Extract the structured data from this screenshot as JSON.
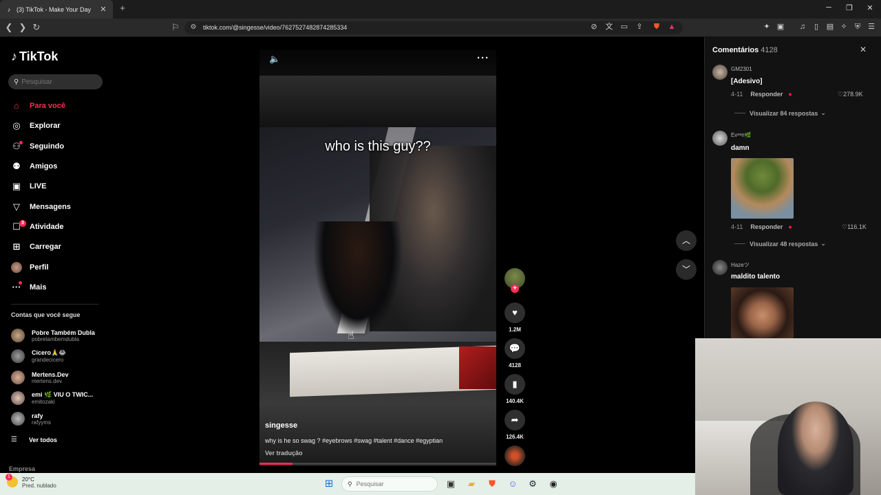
{
  "browser": {
    "tab_title": "(3) TikTok - Make Your Day",
    "url": "tiktok.com/@singesse/video/7627527482874285334",
    "new_tab_symbol": "+"
  },
  "sidebar": {
    "logo": "TikTok",
    "search_placeholder": "Pesquisar",
    "nav": [
      {
        "label": "Para você",
        "icon": "home-icon"
      },
      {
        "label": "Explorar",
        "icon": "compass-icon"
      },
      {
        "label": "Seguindo",
        "icon": "following-icon"
      },
      {
        "label": "Amigos",
        "icon": "friends-icon"
      },
      {
        "label": "LIVE",
        "icon": "live-icon"
      },
      {
        "label": "Mensagens",
        "icon": "messages-icon"
      },
      {
        "label": "Atividade",
        "icon": "activity-icon",
        "badge": "3"
      },
      {
        "label": "Carregar",
        "icon": "upload-icon"
      },
      {
        "label": "Perfil",
        "icon": "profile-avatar"
      },
      {
        "label": "Mais",
        "icon": "more-icon"
      }
    ],
    "following_heading": "Contas que você segue",
    "accounts": [
      {
        "name": "Pobre Também Dubla",
        "handle": "pobretambemdubla"
      },
      {
        "name": "Cicero🙏😂",
        "handle": "grandecicero"
      },
      {
        "name": "Mertens.Dev",
        "handle": "mertens.dev"
      },
      {
        "name": "emi 🌿 VIU O TWIC...",
        "handle": "emitozaki"
      },
      {
        "name": "rafy",
        "handle": "rafyyms"
      }
    ],
    "see_all": "Ver todos",
    "company": "Empresa"
  },
  "video": {
    "caption_overlay": "who is this guy??",
    "author": "singesse",
    "description": "why is he so swag ? #eyebrows #swag #talent #dance #egyptian",
    "translate": "Ver tradução",
    "likes": "1.2M",
    "comments": "4128",
    "saves": "140.4K",
    "shares": "126.4K"
  },
  "comments": {
    "title": "Comentários",
    "count": "4128",
    "items": [
      {
        "user": "GM2301",
        "text": "[Adesivo]",
        "date": "4-11",
        "reply": "Responder",
        "likes": "278.9K",
        "view_replies": "Visualizar 84 respostas"
      },
      {
        "user": "Evᵉᵃn🌿",
        "text": "damn",
        "date": "4-11",
        "reply": "Responder",
        "likes": "116.1K",
        "view_replies": "Visualizar 48 respostas"
      },
      {
        "user": "Hazeツ",
        "text": "maldito talento"
      }
    ]
  },
  "taskbar": {
    "temperature": "20°C",
    "weather": "Pred. nublado",
    "search_placeholder": "Pesquisar"
  }
}
